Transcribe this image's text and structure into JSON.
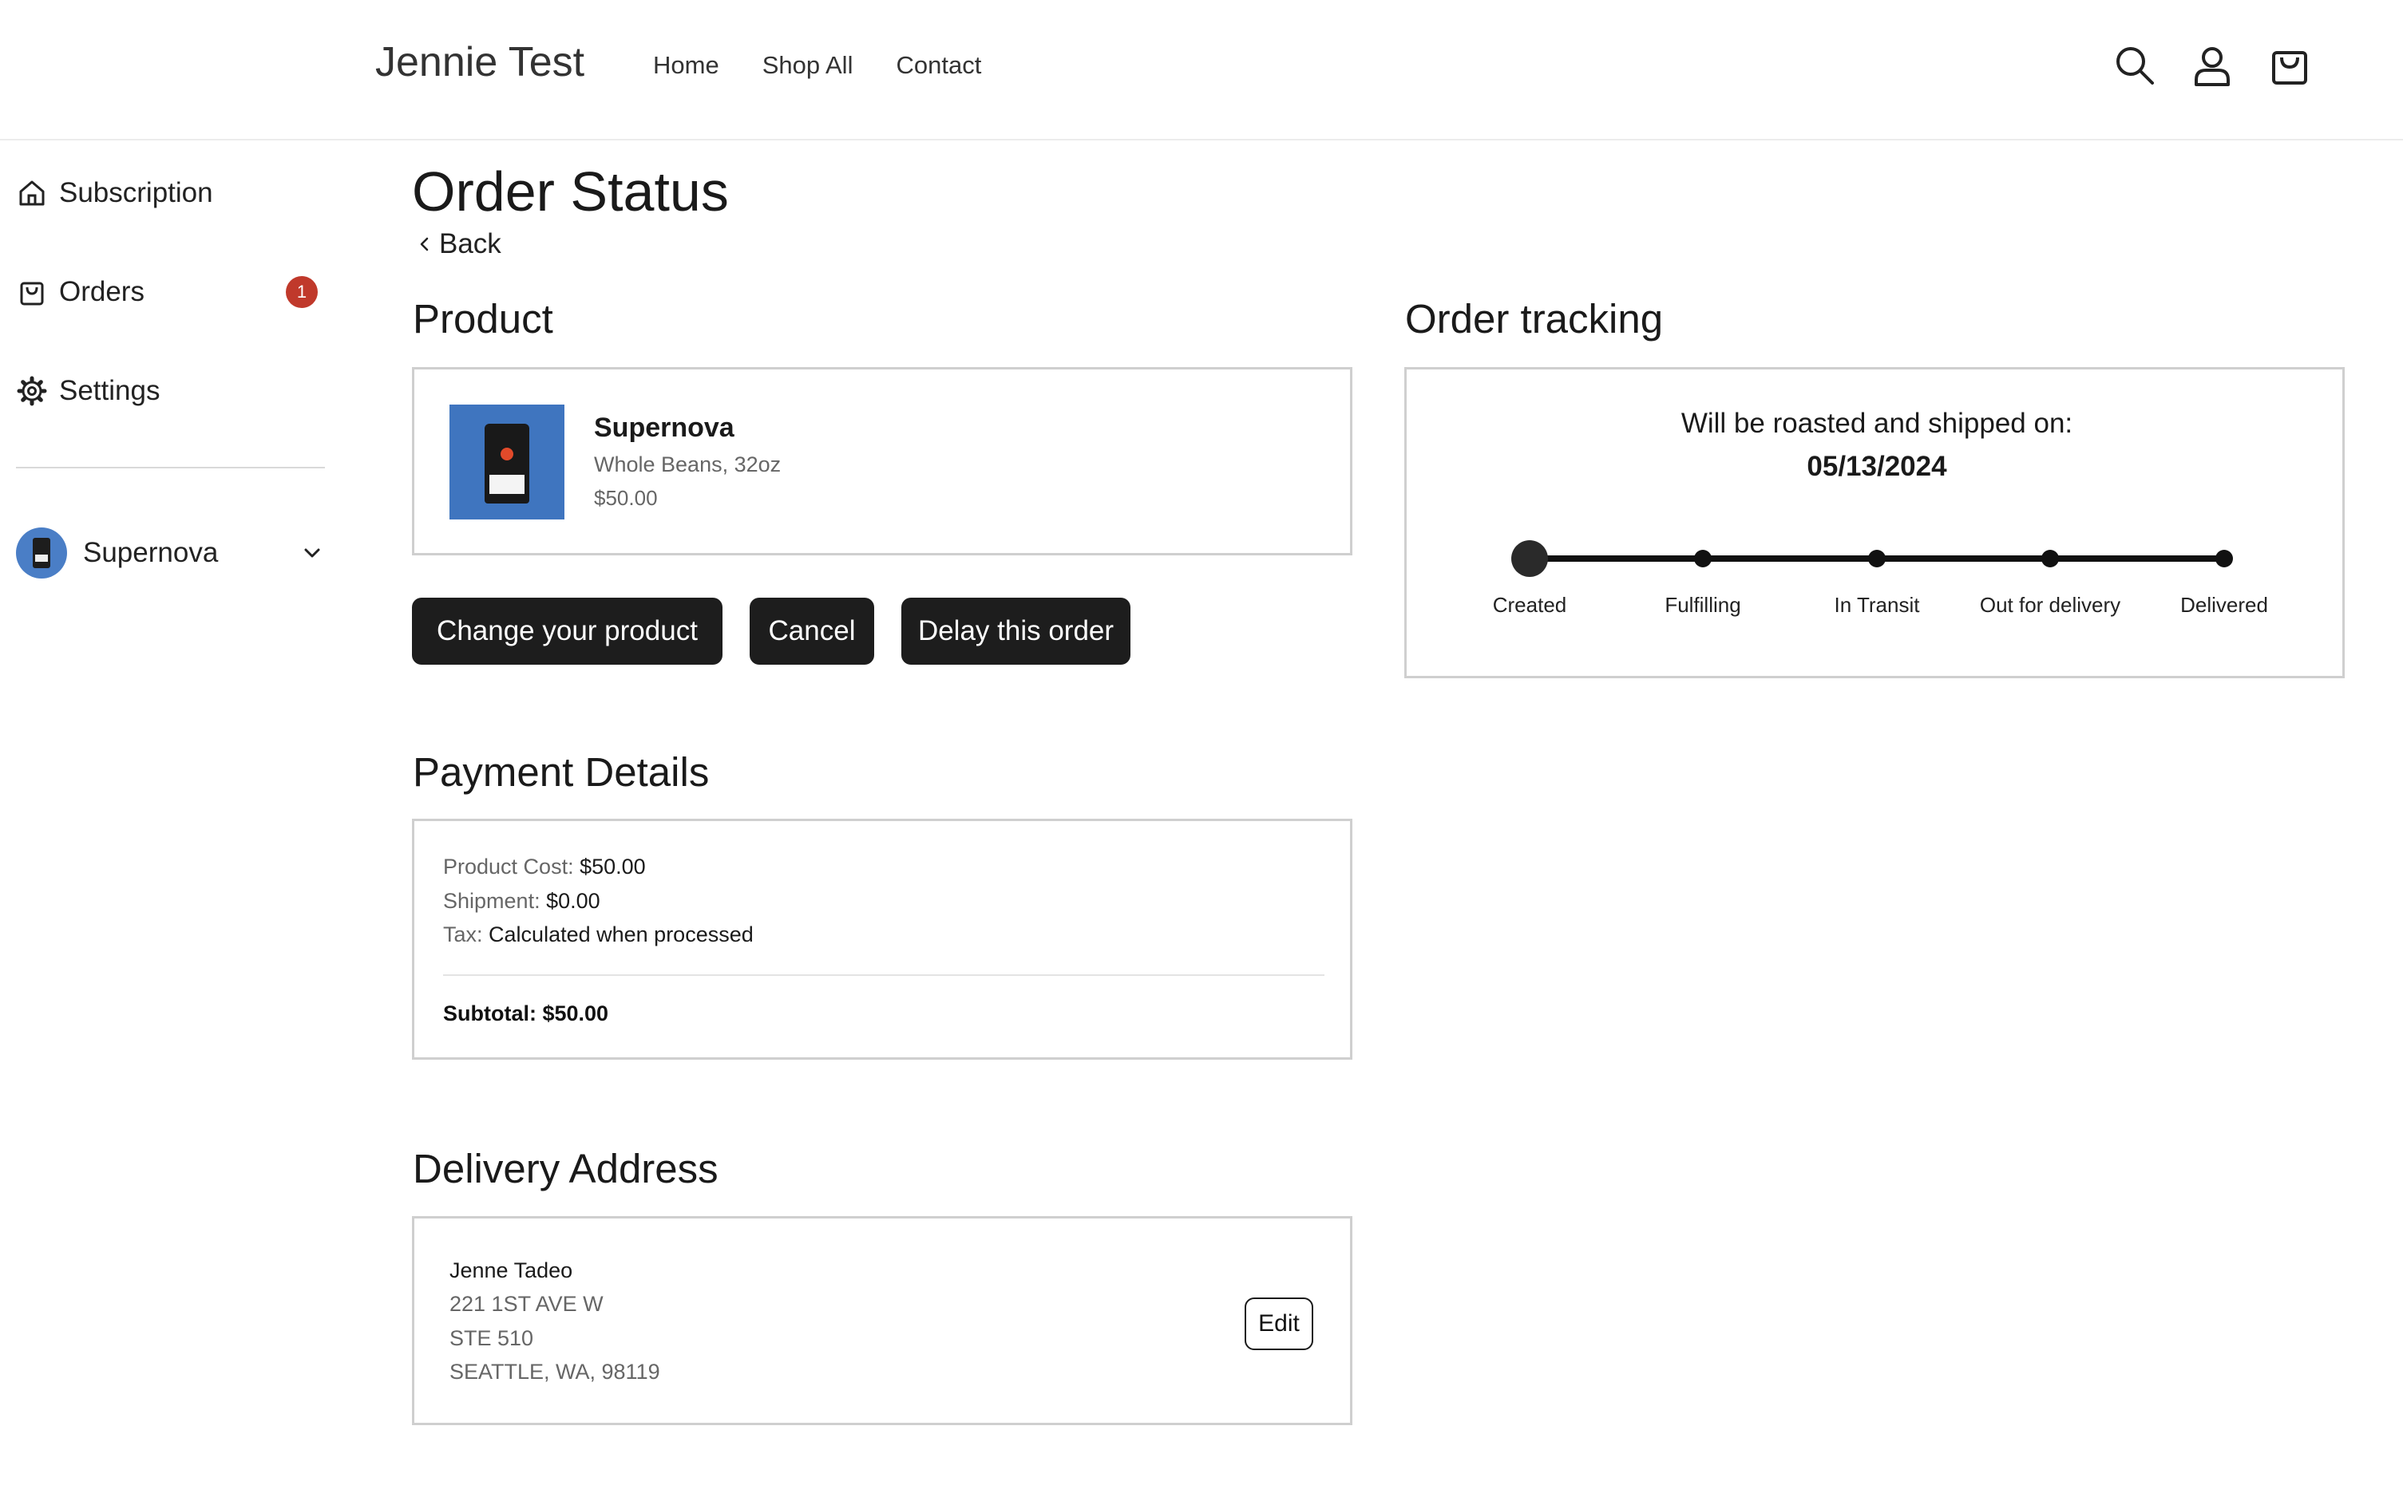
{
  "header": {
    "brand": "Jennie Test",
    "nav": [
      "Home",
      "Shop All",
      "Contact"
    ]
  },
  "sidebar": {
    "items": [
      {
        "label": "Subscription",
        "icon": "home-icon"
      },
      {
        "label": "Orders",
        "icon": "bag-icon",
        "badge": "1"
      },
      {
        "label": "Settings",
        "icon": "gear-icon"
      }
    ],
    "subscription_select": "Supernova"
  },
  "main": {
    "title": "Order Status",
    "back_label": "Back",
    "product": {
      "section_title": "Product",
      "name": "Supernova",
      "variant": "Whole Beans, 32oz",
      "price": "$50.00"
    },
    "buttons": {
      "change": "Change your product",
      "cancel": "Cancel",
      "delay": "Delay this order"
    },
    "payment": {
      "section_title": "Payment Details",
      "product_cost_label": "Product Cost:",
      "product_cost_value": "$50.00",
      "shipment_label": "Shipment:",
      "shipment_value": "$0.00",
      "tax_label": "Tax:",
      "tax_value": "Calculated when processed",
      "subtotal": "Subtotal: $50.00"
    },
    "delivery": {
      "section_title": "Delivery Address",
      "name": "Jenne Tadeo",
      "line1": "221 1ST AVE W",
      "line2": "STE 510",
      "line3": "SEATTLE, WA, 98119",
      "edit_label": "Edit"
    },
    "tracking": {
      "section_title": "Order tracking",
      "caption": "Will be roasted and shipped on:",
      "date": "05/13/2024",
      "steps": [
        "Created",
        "Fulfilling",
        "In Transit",
        "Out for delivery",
        "Delivered"
      ],
      "current_step": "Created"
    }
  },
  "colors": {
    "button": "#1d1d1d",
    "badge": "#c0392b",
    "border": "#cfcfcf",
    "product_bg": "#3f75bf"
  }
}
